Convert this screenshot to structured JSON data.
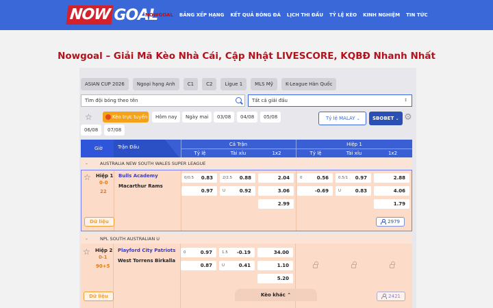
{
  "header": {
    "logo_now": "NOW",
    "logo_goal": "GOAL",
    "nav": [
      "NOWGOAL",
      "BẢNG XẾP HẠNG",
      "KẾT QUẢ BÓNG ĐÁ",
      "LỊCH THI ĐẤU",
      "TỶ LỆ KÈO",
      "KINH NGHIỆM",
      "TIN TỨC"
    ]
  },
  "page_title": "Nowgoal – Giải Mã Kèo Nhà Cái, Cập Nhật LIVESCORE, KQBĐ Nhanh Nhất",
  "chips": [
    "ASIAN CUP 2026",
    "Ngoại hạng Anh",
    "C1",
    "C2",
    "Ligue 1",
    "MLS Mỹ",
    "K-League Hàn Quốc"
  ],
  "search": {
    "placeholder": "Tìm đội bóng theo tên"
  },
  "league_select": {
    "value": "Tất cả giải đấu"
  },
  "filters": {
    "live": "Kèo trực tuyến",
    "dates": [
      "Hôm nay",
      "Ngày mai",
      "03/08",
      "04/08",
      "05/08",
      "06/08",
      "07/08"
    ]
  },
  "odds_select": "Tỷ lệ MALAY",
  "bookmaker": "SBOBET",
  "table_head": {
    "gio": "Giờ",
    "tran_dau": "Trận Đấu",
    "full": "Cả Trận",
    "half": "Hiệp 1",
    "ty_le": "Tỷ lệ",
    "tai_xiu": "Tài xỉu",
    "x12": "1x2"
  },
  "leagues": [
    {
      "name": "AUSTRALIA NEW SOUTH WALES SUPER LEAGUE",
      "match": {
        "period": "Hiệp 1",
        "score": "0-0",
        "minute": "22",
        "home": "Bulls Academy",
        "away": "Macarthur Rams",
        "ft_hdp_line": "0/0.5",
        "ft_hdp_home": "0.83",
        "ft_hdp_away": "0.97",
        "ft_ou_line": "2/2.5",
        "ft_ou_over": "0.88",
        "ft_ou_label": "U",
        "ft_ou_under": "0.92",
        "ft_1": "2.04",
        "ft_x": "3.06",
        "ft_2": "2.99",
        "h1_hdp_line": "0",
        "h1_hdp_home": "0.56",
        "h1_hdp_away": "-0.69",
        "h1_ou_line": "0.5/1",
        "h1_ou_over": "0.97",
        "h1_ou_label": "U",
        "h1_ou_under": "0.83",
        "h1_1": "2.88",
        "h1_x": "4.06",
        "h1_2": "1.79",
        "data_btn": "Dữ liệu",
        "count": "2979"
      }
    },
    {
      "name": "NPL SOUTH AUSTRALIAN U",
      "match": {
        "period": "Hiệp 2",
        "score": "0-1",
        "minute": "90+5",
        "home": "Playford City Patriots",
        "away": "West Torrens Birkalla",
        "ft_hdp_line": "0",
        "ft_hdp_home": "0.97",
        "ft_hdp_away": "0.87",
        "ft_ou_line": "1.5",
        "ft_ou_over": "-0.19",
        "ft_ou_label": "U",
        "ft_ou_under": "0.41",
        "ft_1": "34.00",
        "ft_x": "1.10",
        "ft_2": "5.20",
        "data_btn": "Dữ liệu",
        "count": "2421",
        "more": "Kèo khác"
      }
    }
  ]
}
